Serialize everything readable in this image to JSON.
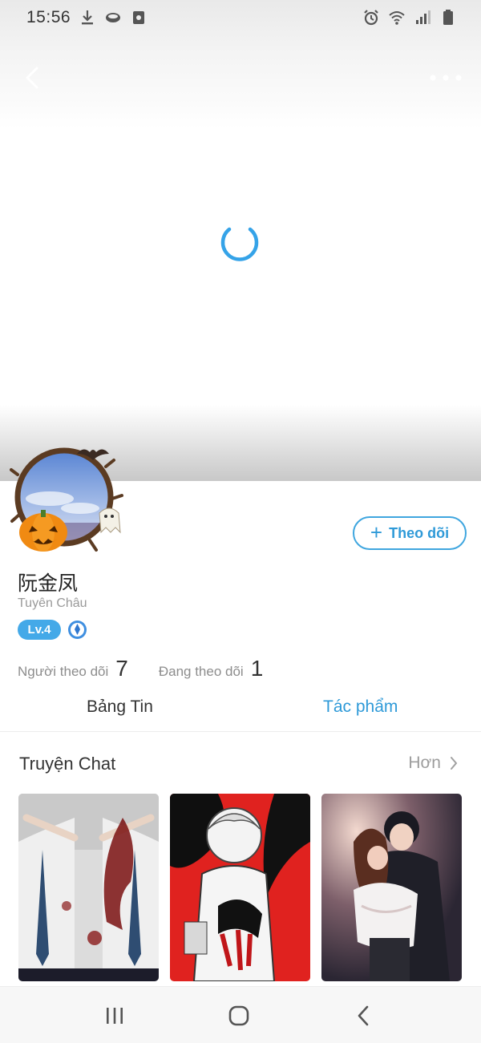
{
  "status_bar": {
    "time": "15:56",
    "left_icons": [
      "download-icon",
      "cloud-icon",
      "screen-record-icon"
    ],
    "right_icons": [
      "alarm-icon",
      "wifi-icon",
      "signal-icon",
      "battery-icon"
    ]
  },
  "header": {
    "back_icon": "chevron-left-icon",
    "more_icon": "more-dots-icon",
    "loading_icon": "loading-spinner-icon"
  },
  "profile": {
    "name": "阮金凤",
    "location": "Tuyên Châu",
    "level": "Lv.4",
    "follow_label": "Theo dõi",
    "followers_label": "Người theo dõi",
    "followers_count": "7",
    "following_label": "Đang theo dõi",
    "following_count": "1"
  },
  "tabs": [
    {
      "label": "Bảng Tin",
      "active": false
    },
    {
      "label": "Tác phẩm",
      "active": true
    }
  ],
  "section": {
    "title": "Truyện Chat",
    "more_label": "Hơn"
  },
  "colors": {
    "accent": "#2f9ad8",
    "level_badge": "#44a9e8",
    "muted_text": "#9a9a9a"
  },
  "navbar": {
    "icons": [
      "recent-apps-icon",
      "home-icon",
      "back-icon"
    ]
  }
}
